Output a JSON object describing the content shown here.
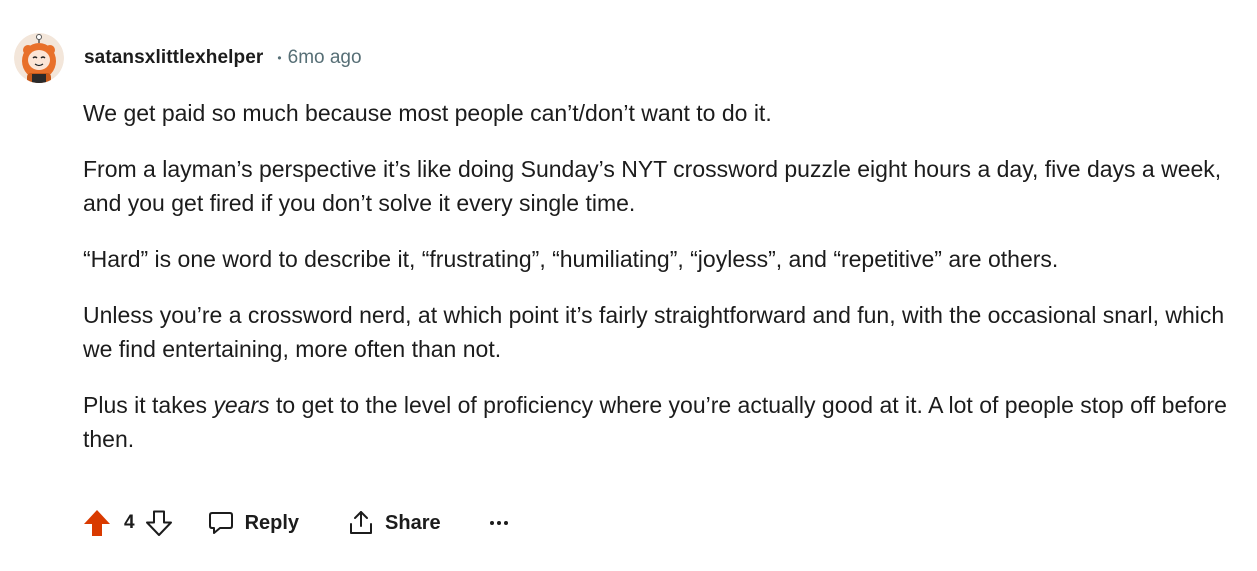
{
  "comment": {
    "author": "satansxlittlexhelper",
    "separator": "•",
    "timestamp": "6mo ago",
    "paragraphs": [
      {
        "text": "We get paid so much because most people can’t/don’t want to do it."
      },
      {
        "text": "From a layman’s perspective it’s like doing Sunday’s NYT crossword puzzle eight hours a day, five days a week, and you get fired if you don’t solve it every single time."
      },
      {
        "text": "“Hard” is one word to describe it, “frustrating”, “humiliating”, “joyless”, and “repetitive” are others."
      },
      {
        "text": "Unless you’re a crossword nerd, at which point it’s fairly straightforward and fun, with the occasional snarl, which we find entertaining, more often than not."
      },
      {
        "before": "Plus it takes ",
        "emphasis": "years",
        "after": " to get to the level of proficiency where you’re actually good at it. A lot of people stop off before then."
      }
    ]
  },
  "actions": {
    "score": "4",
    "reply_label": "Reply",
    "share_label": "Share",
    "more_icon": "ellipsis-icon",
    "upvote_icon": "upvote-arrow-icon",
    "downvote_icon": "downvote-arrow-icon",
    "reply_icon": "speech-bubble-icon",
    "share_icon": "share-upload-icon",
    "upvote_color": "#d93a00"
  },
  "colors": {
    "text": "#1c1c1c",
    "meta": "#576f76",
    "avatar_accent": "#e8702a"
  }
}
